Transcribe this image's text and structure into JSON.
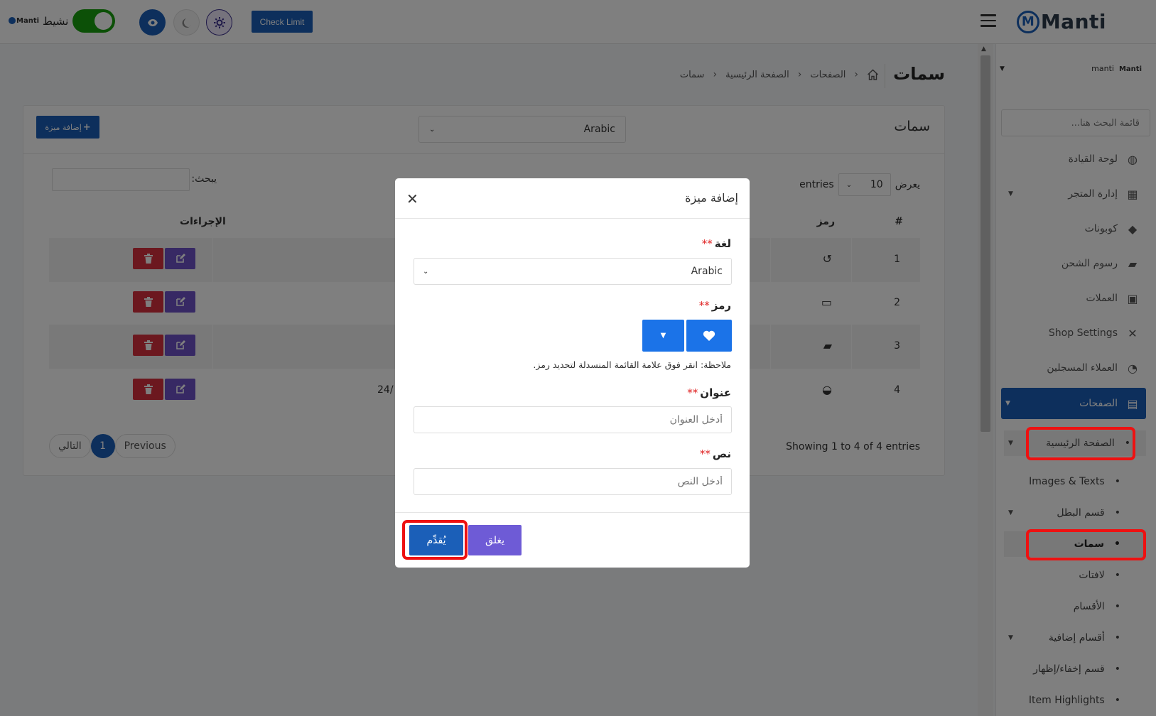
{
  "topbar": {
    "brand": "Manti",
    "brand_initial": "M",
    "mini_brand": "Manti",
    "status_label": "نشيط",
    "check_limit": "Check Limit"
  },
  "sidebar": {
    "user_name": "manti",
    "user_brand": "Manti",
    "search_placeholder": "قائمة البحث هنا...",
    "items": [
      {
        "label": "لوحة القيادة",
        "icon": "palette-icon"
      },
      {
        "label": "إدارة المتجر",
        "icon": "store-icon"
      },
      {
        "label": "كوبونات",
        "icon": "tags-icon"
      },
      {
        "label": "رسوم الشحن",
        "icon": "truck-icon"
      },
      {
        "label": "العملات",
        "icon": "money-icon"
      },
      {
        "label": "Shop Settings",
        "icon": "tools-icon"
      },
      {
        "label": "العملاء المسجلين",
        "icon": "user-icon"
      },
      {
        "label": "الصفحات",
        "icon": "file-icon"
      }
    ],
    "sub_items": [
      {
        "label": "الصفحة الرئيسية"
      },
      {
        "label": "Images & Texts"
      },
      {
        "label": "قسم البطل"
      },
      {
        "label": "سمات"
      },
      {
        "label": "لافتات"
      },
      {
        "label": "الأقسام"
      },
      {
        "label": "أقسام إضافية"
      },
      {
        "label": "قسم إخفاء/إظهار"
      },
      {
        "label": "Item Highlights"
      }
    ]
  },
  "page": {
    "title": "سمات",
    "breadcrumb": [
      "الصفحات",
      "الصفحة الرئيسية",
      "سمات"
    ]
  },
  "card": {
    "title": "سمات",
    "language": "Arabic",
    "add_button": "إضافة ميزة",
    "show_label": "يعرض",
    "entries_value": "10",
    "entries_label": "entries",
    "search_label": "يبحث:",
    "headers": {
      "num": "#",
      "icon": "رمز",
      "actions": "الإجراءات"
    },
    "rows": [
      {
        "num": "1",
        "icon": "undo-icon",
        "text": ""
      },
      {
        "num": "2",
        "icon": "credit-card-icon",
        "text": ""
      },
      {
        "num": "3",
        "icon": "shipping-truck-icon",
        "text": ""
      },
      {
        "num": "4",
        "icon": "headset-icon",
        "text": "24/"
      }
    ],
    "showing": "Showing 1 to 4 of 4 entries",
    "pager": {
      "next": "التالي",
      "current": "1",
      "previous": "Previous"
    }
  },
  "modal": {
    "title": "إضافة ميزة",
    "lang_label": "لغة",
    "lang_value": "Arabic",
    "icon_label": "رمز",
    "note": "ملاحظة: انقر فوق علامة القائمة المنسدلة لتحديد رمز.",
    "title_label": "عنوان",
    "title_placeholder": "أدخل العنوان",
    "text_label": "نص",
    "text_placeholder": "أدخل النص",
    "required_mark": "**",
    "close_btn": "يغلق",
    "submit_btn": "يُقدِّم"
  },
  "colors": {
    "primary": "#1b5fb8",
    "edit": "#6f52c9",
    "delete": "#d9313f",
    "toggle": "#18a00f",
    "highlight": "#e11111"
  }
}
